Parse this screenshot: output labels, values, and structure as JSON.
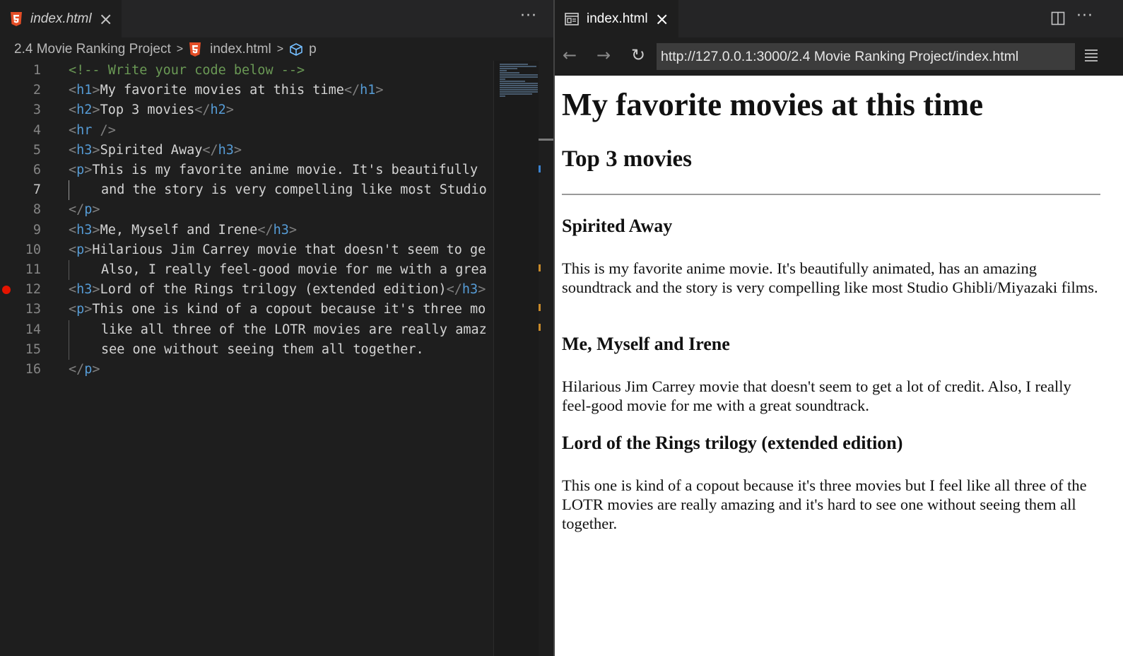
{
  "editor": {
    "tab": {
      "title": "index.html",
      "close": "×"
    },
    "more": "···",
    "breadcrumb": {
      "folder": "2.4 Movie Ranking Project",
      "file": "index.html",
      "symbol": "p",
      "separator": ">"
    },
    "lines": [
      {
        "n": "1",
        "comment": "<!-- Write your code below -->"
      },
      {
        "n": "2",
        "tag": "h1",
        "text": "My favorite movies at this time"
      },
      {
        "n": "3",
        "tag": "h2",
        "text": "Top 3 movies"
      },
      {
        "n": "4",
        "void": "hr"
      },
      {
        "n": "5",
        "tag": "h3",
        "text": "Spirited Away"
      },
      {
        "n": "6",
        "open": "p",
        "text": "This is my favorite anime movie. It's beautifully"
      },
      {
        "n": "7",
        "text": "and the story is very compelling like most Studio"
      },
      {
        "n": "8",
        "close": "p"
      },
      {
        "n": "9",
        "tag": "h3",
        "text": "Me, Myself and Irene"
      },
      {
        "n": "10",
        "open": "p",
        "text": "Hilarious Jim Carrey movie that doesn't seem to ge"
      },
      {
        "n": "11",
        "text": "Also, I really feel-good movie for me with a grea"
      },
      {
        "n": "12",
        "tag": "h3",
        "text": "Lord of the Rings trilogy (extended edition)"
      },
      {
        "n": "13",
        "open": "p",
        "text": "This one is kind of a copout because it's three mo"
      },
      {
        "n": "14",
        "text": "like all three of the LOTR movies are really amaz"
      },
      {
        "n": "15",
        "text": "see one without seeing them all together."
      },
      {
        "n": "16",
        "close": "p"
      }
    ],
    "hr_literal": "<hr />"
  },
  "preview": {
    "tab": {
      "title": "index.html",
      "close": "×"
    },
    "more": "···",
    "nav": {
      "back": "←",
      "forward": "→",
      "reload": "↻"
    },
    "url": "http://127.0.0.1:3000/2.4 Movie Ranking Project/index.html",
    "page": {
      "h1": "My favorite movies at this time",
      "h2": "Top 3 movies",
      "movies": [
        {
          "title": "Spirited Away",
          "desc": "This is my favorite anime movie. It's beautifully animated, has an amazing soundtrack and the story is very compelling like most Studio Ghibli/Miyazaki films."
        },
        {
          "title": "Me, Myself and Irene",
          "desc": "Hilarious Jim Carrey movie that doesn't seem to get a lot of credit. Also, I really feel-good movie for me with a great soundtrack."
        },
        {
          "title": "Lord of the Rings trilogy (extended edition)",
          "desc": "This one is kind of a copout because it's three movies but I feel like all three of the LOTR movies are really amazing and it's hard to see one without seeing them all together."
        }
      ]
    }
  },
  "colors": {
    "editor_bg": "#1e1e1e",
    "tag_bracket": "#808080",
    "tag_name": "#569cd6",
    "comment": "#6a9955",
    "text": "#d4d4d4",
    "html5_orange": "#e44d26",
    "breakpoint": "#e51400"
  }
}
